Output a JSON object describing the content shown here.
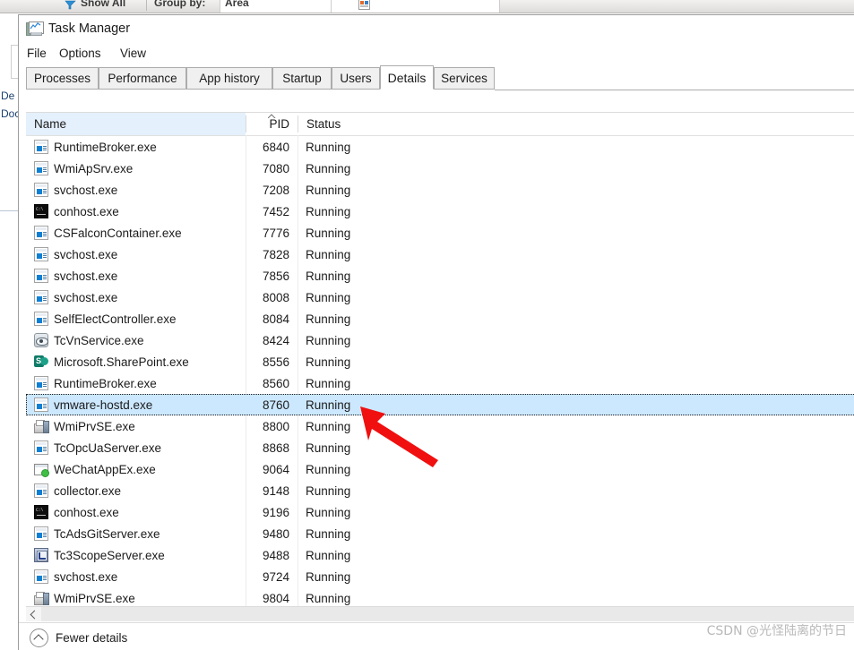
{
  "background": {
    "toolbar_items": [
      {
        "label": "Show All",
        "icon": "show-all-icon"
      },
      {
        "label": "Group by:",
        "icon": null
      },
      {
        "label": "Area",
        "icon": null
      }
    ],
    "tree_items": [
      "De",
      "Doc"
    ]
  },
  "window": {
    "title": "Task Manager",
    "icon": "task-manager-monitor-icon"
  },
  "menu": {
    "items": [
      "File",
      "Options",
      "View"
    ]
  },
  "tabs": {
    "items": [
      {
        "label": "Processes",
        "active": false
      },
      {
        "label": "Performance",
        "active": false
      },
      {
        "label": "App history",
        "active": false
      },
      {
        "label": "Startup",
        "active": false
      },
      {
        "label": "Users",
        "active": false
      },
      {
        "label": "Details",
        "active": true
      },
      {
        "label": "Services",
        "active": false
      }
    ]
  },
  "table": {
    "columns": [
      {
        "key": "name",
        "label": "Name",
        "highlighted": true,
        "sorted": false
      },
      {
        "key": "pid",
        "label": "PID",
        "highlighted": false,
        "sorted": true,
        "sort_direction": "ascending"
      },
      {
        "key": "status",
        "label": "Status",
        "highlighted": false,
        "sorted": false
      }
    ],
    "rows": [
      {
        "name": "RuntimeBroker.exe",
        "pid": "6840",
        "status": "Running",
        "icon": "app-window-icon",
        "selected": false
      },
      {
        "name": "WmiApSrv.exe",
        "pid": "7080",
        "status": "Running",
        "icon": "app-window-icon",
        "selected": false
      },
      {
        "name": "svchost.exe",
        "pid": "7208",
        "status": "Running",
        "icon": "app-window-icon",
        "selected": false
      },
      {
        "name": "conhost.exe",
        "pid": "7452",
        "status": "Running",
        "icon": "console-icon",
        "selected": false
      },
      {
        "name": "CSFalconContainer.exe",
        "pid": "7776",
        "status": "Running",
        "icon": "app-window-icon",
        "selected": false
      },
      {
        "name": "svchost.exe",
        "pid": "7828",
        "status": "Running",
        "icon": "app-window-icon",
        "selected": false
      },
      {
        "name": "svchost.exe",
        "pid": "7856",
        "status": "Running",
        "icon": "app-window-icon",
        "selected": false
      },
      {
        "name": "svchost.exe",
        "pid": "8008",
        "status": "Running",
        "icon": "app-window-icon",
        "selected": false
      },
      {
        "name": "SelfElectController.exe",
        "pid": "8084",
        "status": "Running",
        "icon": "app-window-icon",
        "selected": false
      },
      {
        "name": "TcVnService.exe",
        "pid": "8424",
        "status": "Running",
        "icon": "eye-icon",
        "selected": false
      },
      {
        "name": "Microsoft.SharePoint.exe",
        "pid": "8556",
        "status": "Running",
        "icon": "sharepoint-icon",
        "selected": false
      },
      {
        "name": "RuntimeBroker.exe",
        "pid": "8560",
        "status": "Running",
        "icon": "app-window-icon",
        "selected": false
      },
      {
        "name": "vmware-hostd.exe",
        "pid": "8760",
        "status": "Running",
        "icon": "app-window-icon",
        "selected": true
      },
      {
        "name": "WmiPrvSE.exe",
        "pid": "8800",
        "status": "Running",
        "icon": "server-icon",
        "selected": false
      },
      {
        "name": "TcOpcUaServer.exe",
        "pid": "8868",
        "status": "Running",
        "icon": "app-window-icon",
        "selected": false
      },
      {
        "name": "WeChatAppEx.exe",
        "pid": "9064",
        "status": "Running",
        "icon": "wechat-app-icon",
        "selected": false
      },
      {
        "name": "collector.exe",
        "pid": "9148",
        "status": "Running",
        "icon": "app-window-icon",
        "selected": false
      },
      {
        "name": "conhost.exe",
        "pid": "9196",
        "status": "Running",
        "icon": "console-icon",
        "selected": false
      },
      {
        "name": "TcAdsGitServer.exe",
        "pid": "9480",
        "status": "Running",
        "icon": "app-window-icon",
        "selected": false
      },
      {
        "name": "Tc3ScopeServer.exe",
        "pid": "9488",
        "status": "Running",
        "icon": "scope-icon",
        "selected": false
      },
      {
        "name": "svchost.exe",
        "pid": "9724",
        "status": "Running",
        "icon": "app-window-icon",
        "selected": false
      },
      {
        "name": "WmiPrvSE.exe",
        "pid": "9804",
        "status": "Running",
        "icon": "server-icon",
        "selected": false
      }
    ]
  },
  "footer": {
    "fewer_details_label": "Fewer details",
    "fewer_details_icon": "chevron-up-circle-icon"
  },
  "watermark": {
    "text": "CSDN @光怪陆离的节日"
  },
  "colors": {
    "selection_background": "#cce8ff",
    "header_highlight": "#e4f0fb",
    "annotation_arrow": "#f01010",
    "accent_blue": "#0f7fd4"
  }
}
